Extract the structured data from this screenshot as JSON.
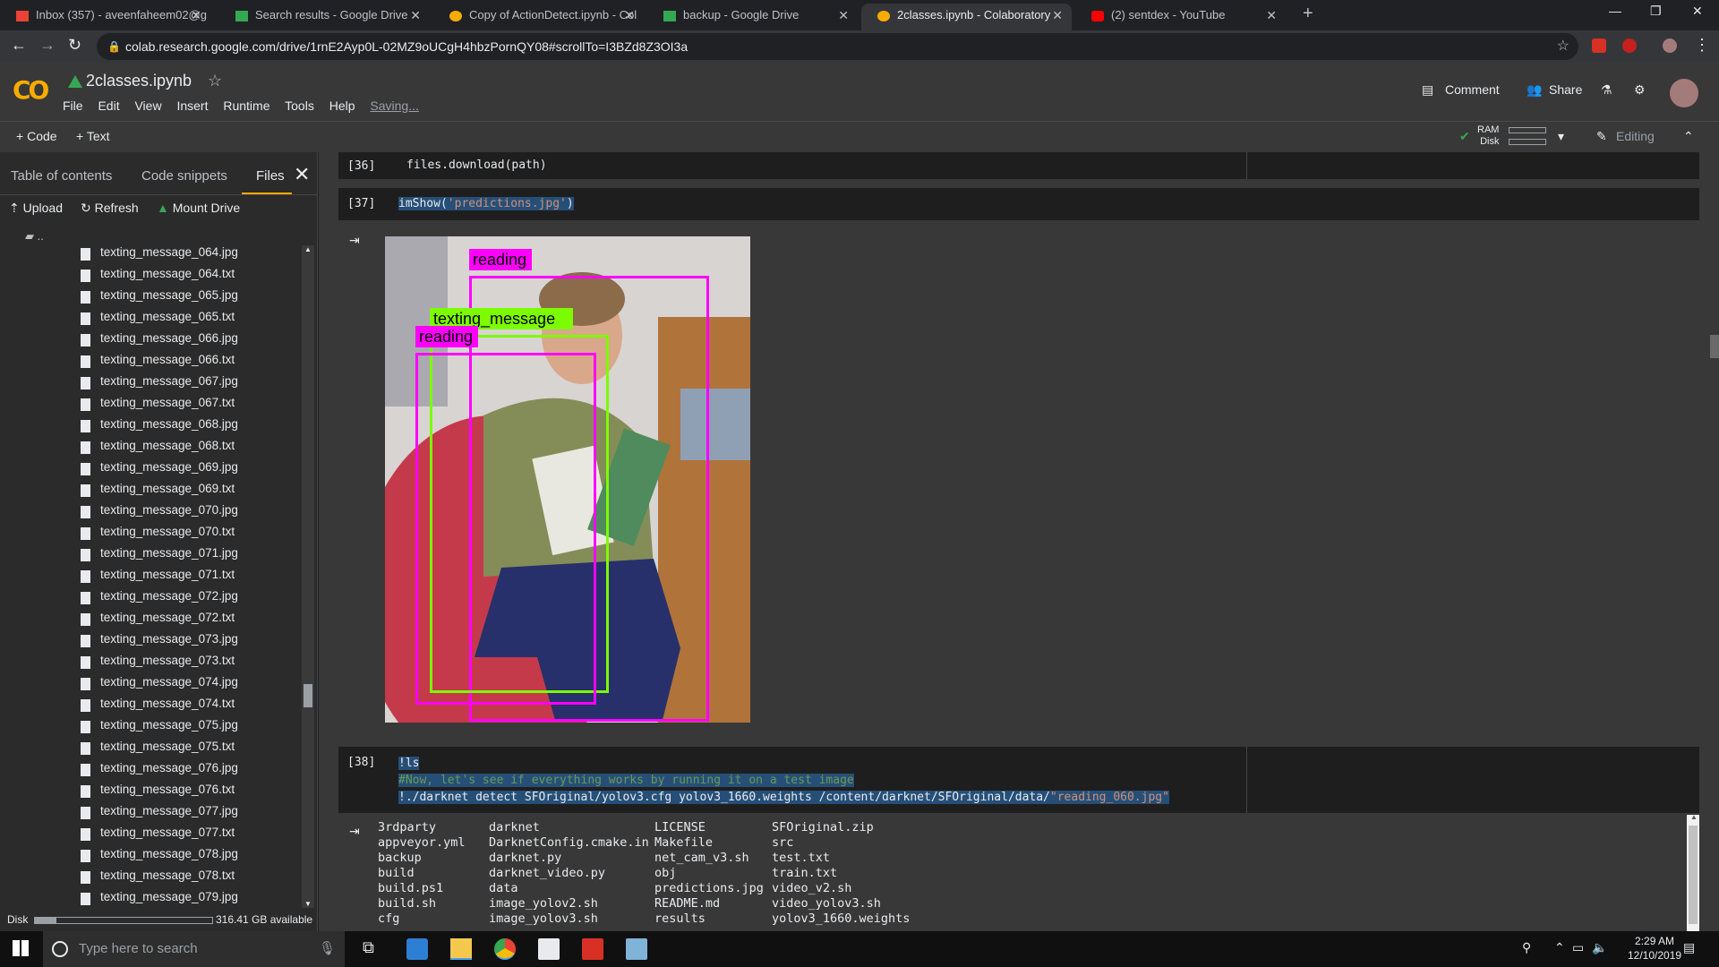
{
  "browser": {
    "tabs": [
      {
        "title": "Inbox (357) - aveenfaheem02@g",
        "active": false
      },
      {
        "title": "Search results - Google Drive",
        "active": false
      },
      {
        "title": "Copy of ActionDetect.ipynb - Col",
        "active": false
      },
      {
        "title": "backup - Google Drive",
        "active": false
      },
      {
        "title": "2classes.ipynb - Colaboratory",
        "active": true
      },
      {
        "title": "(2) sentdex - YouTube",
        "active": false
      }
    ],
    "url": "colab.research.google.com/drive/1rnE2Ayp0L-02MZ9oUCgH4hbzPornQY08#scrollTo=I3BZd8Z3OI3a"
  },
  "colab": {
    "logo": "CO",
    "title": "2classes.ipynb",
    "menu": [
      "File",
      "Edit",
      "View",
      "Insert",
      "Runtime",
      "Tools",
      "Help"
    ],
    "saving": "Saving...",
    "comment": "Comment",
    "share": "Share"
  },
  "toolbar": {
    "code": "Code",
    "text": "Text",
    "ram": "RAM",
    "disk": "Disk",
    "editing": "Editing"
  },
  "sidebar": {
    "tabs": [
      "Table of contents",
      "Code snippets",
      "Files"
    ],
    "upload": "Upload",
    "refresh": "Refresh",
    "mount": "Mount Drive",
    "parent": "..",
    "files": [
      "texting_message_064.jpg",
      "texting_message_064.txt",
      "texting_message_065.jpg",
      "texting_message_065.txt",
      "texting_message_066.jpg",
      "texting_message_066.txt",
      "texting_message_067.jpg",
      "texting_message_067.txt",
      "texting_message_068.jpg",
      "texting_message_068.txt",
      "texting_message_069.jpg",
      "texting_message_069.txt",
      "texting_message_070.jpg",
      "texting_message_070.txt",
      "texting_message_071.jpg",
      "texting_message_071.txt",
      "texting_message_072.jpg",
      "texting_message_072.txt",
      "texting_message_073.jpg",
      "texting_message_073.txt",
      "texting_message_074.jpg",
      "texting_message_074.txt",
      "texting_message_075.jpg",
      "texting_message_075.txt",
      "texting_message_076.jpg",
      "texting_message_076.txt",
      "texting_message_077.jpg",
      "texting_message_077.txt",
      "texting_message_078.jpg",
      "texting_message_078.txt",
      "texting_message_079.jpg"
    ],
    "disk_label": "Disk",
    "disk_available": "316.41 GB available"
  },
  "cells": {
    "c36": {
      "exec": "[36]",
      "code": "files.download(path)"
    },
    "c37": {
      "exec": "[37]",
      "code_fn": "imShow(",
      "code_str": "'predictions.jpg'",
      "code_end": ")"
    },
    "detections": [
      {
        "label": "reading",
        "color": "#ff00ff"
      },
      {
        "label": "texting_message",
        "color": "#7cfc00"
      },
      {
        "label": "reading",
        "color": "#ff00ff"
      }
    ],
    "c38": {
      "exec": "[38]",
      "line1": "!ls",
      "line2": "#Now, let's see if everything works by running it on a test image",
      "line3_cmd": "!./darknet detect SFOriginal/yolov3.cfg yolov3_1660.weights /content/darknet/SFOriginal/data/",
      "line3_str": "\"reading_060.jpg\""
    },
    "ls_output": [
      [
        "3rdparty",
        "appveyor.yml",
        "backup",
        "build",
        "build.ps1",
        "build.sh",
        "cfg"
      ],
      [
        "darknet",
        "DarknetConfig.cmake.in",
        "darknet.py",
        "darknet_video.py",
        "data",
        "image_yolov2.sh",
        "image_yolov3.sh"
      ],
      [
        "LICENSE",
        "Makefile",
        "net_cam_v3.sh",
        "obj",
        "predictions.jpg",
        "README.md",
        "results"
      ],
      [
        "SFOriginal.zip",
        "src",
        "test.txt",
        "train.txt",
        "video_v2.sh",
        "video_yolov3.sh",
        "yolov3_1660.weights"
      ]
    ]
  },
  "taskbar": {
    "search_placeholder": "Type here to search",
    "time": "2:29 AM",
    "date": "12/10/2019"
  }
}
